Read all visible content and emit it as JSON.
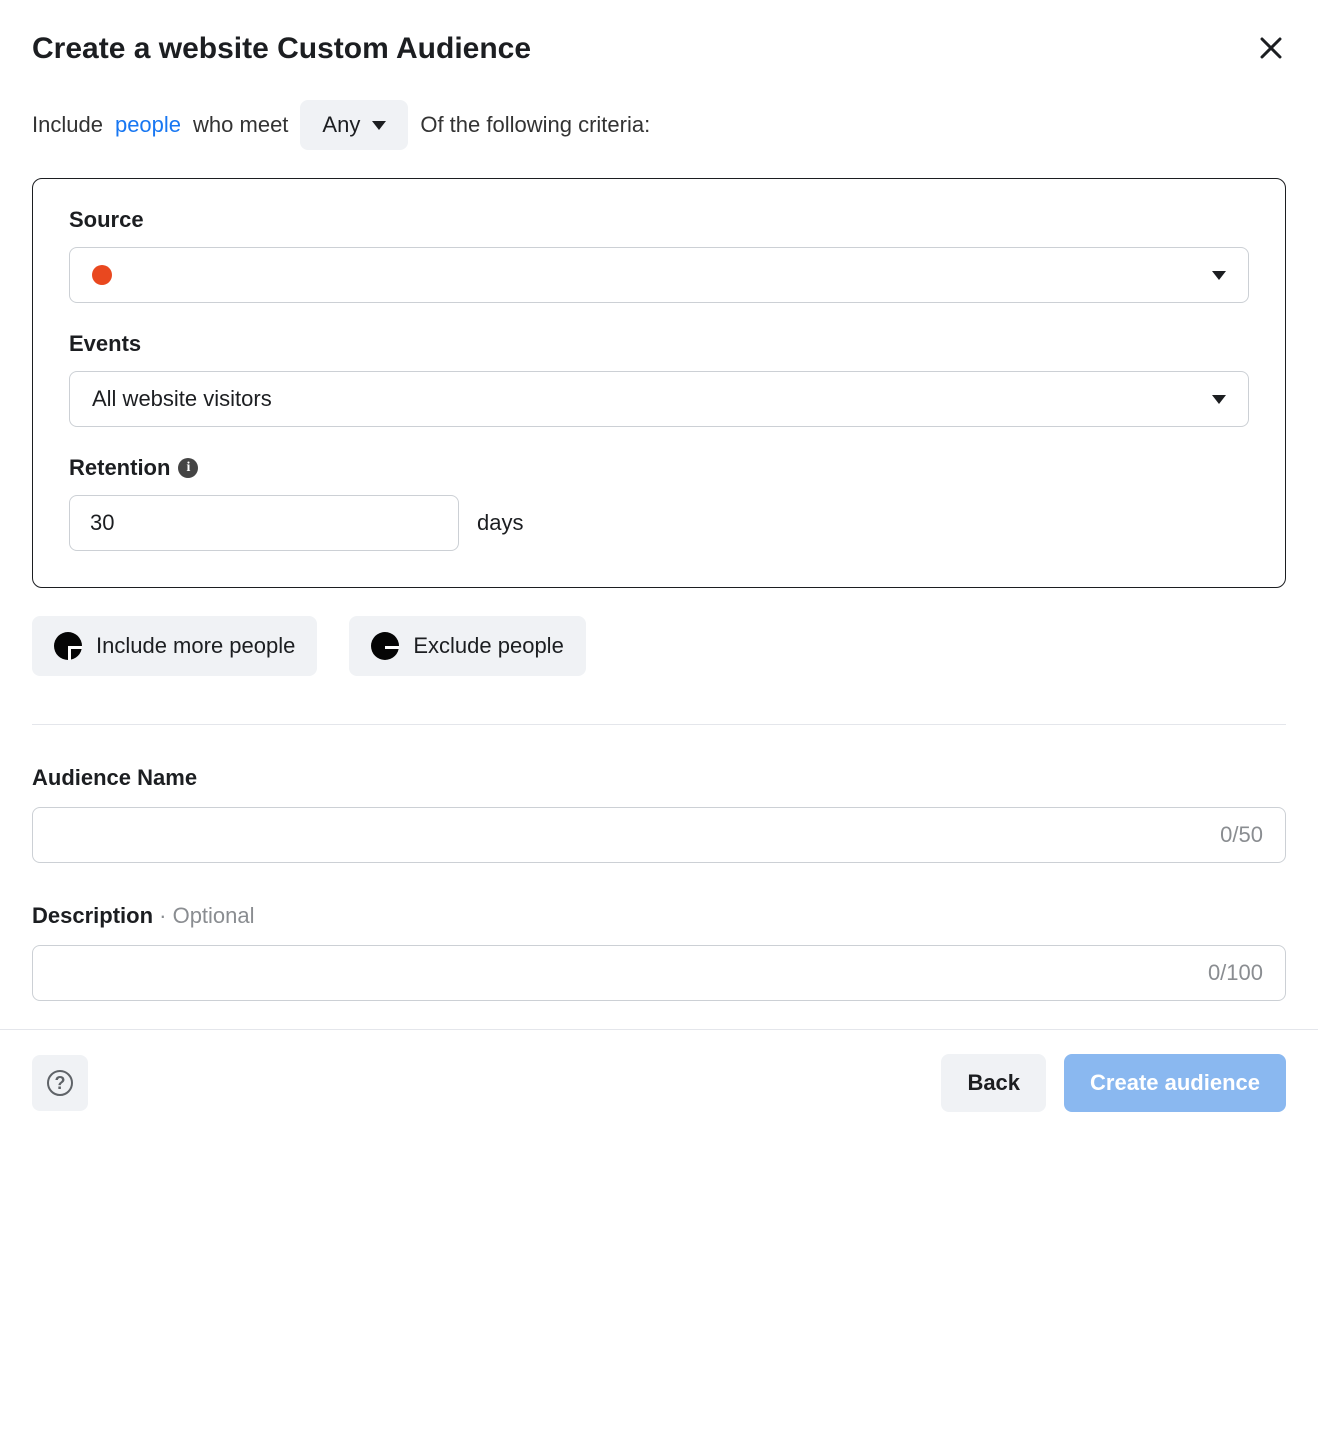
{
  "header": {
    "title": "Create a website Custom Audience"
  },
  "criteria": {
    "prefix": "Include",
    "people_link": "people",
    "who_meet": "who meet",
    "any_label": "Any",
    "suffix": "Of the following criteria:"
  },
  "box": {
    "source_label": "Source",
    "source_value": "",
    "events_label": "Events",
    "events_value": "All website visitors",
    "retention_label": "Retention",
    "retention_value": "30",
    "retention_unit": "days"
  },
  "actions": {
    "include_more": "Include more people",
    "exclude": "Exclude people"
  },
  "audience_name": {
    "label": "Audience Name",
    "value": "",
    "counter": "0/50"
  },
  "description": {
    "label": "Description",
    "optional_flag": " · Optional",
    "value": "",
    "counter": "0/100"
  },
  "footer": {
    "back": "Back",
    "create": "Create audience"
  }
}
